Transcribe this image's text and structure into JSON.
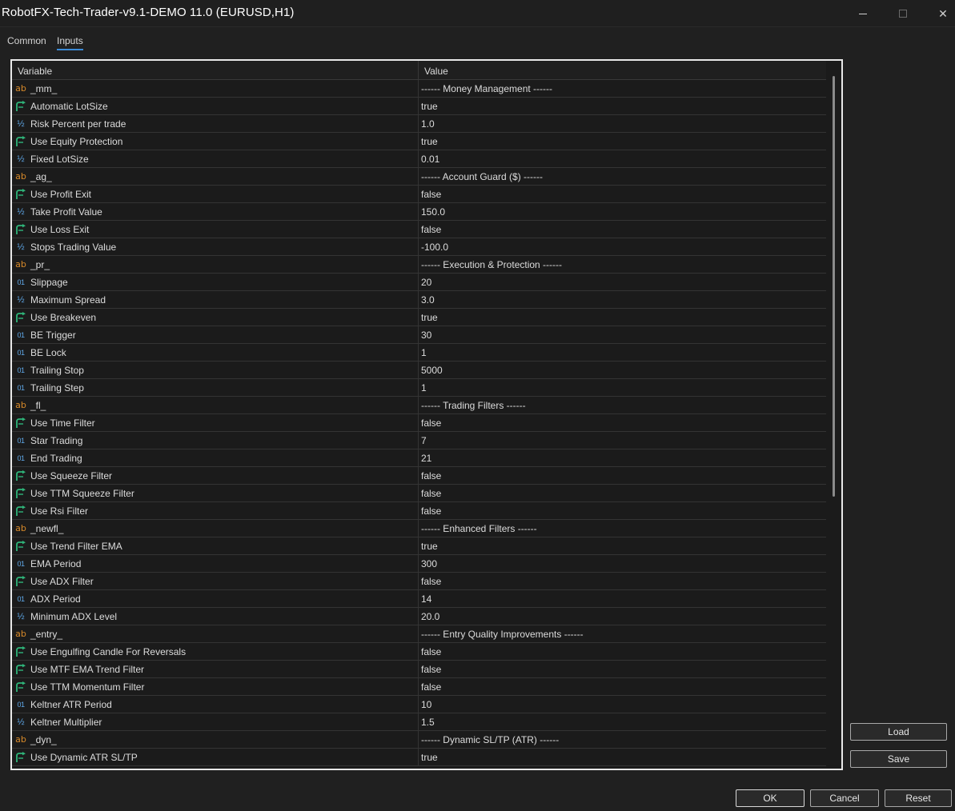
{
  "window": {
    "title": "RobotFX-Tech-Trader-v9.1-DEMO 11.0 (EURUSD,H1)",
    "close_glyph": "✕"
  },
  "tabs": [
    {
      "label": "Common",
      "active": false
    },
    {
      "label": "Inputs",
      "active": true
    }
  ],
  "table": {
    "headers": {
      "variable": "Variable",
      "value": "Value"
    },
    "rows": [
      {
        "type": "string",
        "icon": "ab",
        "name": "_mm_",
        "value": "------ Money Management ------"
      },
      {
        "type": "bool",
        "icon": "",
        "name": "Automatic LotSize",
        "value": "true"
      },
      {
        "type": "double",
        "icon": "½",
        "name": "Risk Percent per trade",
        "value": "1.0"
      },
      {
        "type": "bool",
        "icon": "",
        "name": "Use Equity Protection",
        "value": "true"
      },
      {
        "type": "double",
        "icon": "½",
        "name": "Fixed LotSize",
        "value": "0.01"
      },
      {
        "type": "string",
        "icon": "ab",
        "name": "_ag_",
        "value": "------ Account Guard ($) ------"
      },
      {
        "type": "bool",
        "icon": "",
        "name": "Use Profit Exit",
        "value": "false"
      },
      {
        "type": "double",
        "icon": "½",
        "name": "Take Profit Value",
        "value": "150.0"
      },
      {
        "type": "bool",
        "icon": "",
        "name": "Use Loss Exit",
        "value": "false"
      },
      {
        "type": "double",
        "icon": "½",
        "name": "Stops Trading Value",
        "value": "-100.0"
      },
      {
        "type": "string",
        "icon": "ab",
        "name": "_pr_",
        "value": "------ Execution & Protection ------"
      },
      {
        "type": "int",
        "icon": "01",
        "name": "Slippage",
        "value": "20"
      },
      {
        "type": "double",
        "icon": "½",
        "name": "Maximum Spread",
        "value": "3.0"
      },
      {
        "type": "bool",
        "icon": "",
        "name": "Use Breakeven",
        "value": "true"
      },
      {
        "type": "int",
        "icon": "01",
        "name": "BE Trigger",
        "value": "30"
      },
      {
        "type": "int",
        "icon": "01",
        "name": "BE Lock",
        "value": "1"
      },
      {
        "type": "int",
        "icon": "01",
        "name": "Trailing Stop",
        "value": "5000"
      },
      {
        "type": "int",
        "icon": "01",
        "name": "Trailing Step",
        "value": "1"
      },
      {
        "type": "string",
        "icon": "ab",
        "name": "_fl_",
        "value": "------ Trading Filters ------"
      },
      {
        "type": "bool",
        "icon": "",
        "name": "Use Time Filter",
        "value": "false"
      },
      {
        "type": "int",
        "icon": "01",
        "name": "Star Trading",
        "value": "7"
      },
      {
        "type": "int",
        "icon": "01",
        "name": "End Trading",
        "value": "21"
      },
      {
        "type": "bool",
        "icon": "",
        "name": "Use Squeeze Filter",
        "value": "false"
      },
      {
        "type": "bool",
        "icon": "",
        "name": "Use TTM Squeeze Filter",
        "value": "false"
      },
      {
        "type": "bool",
        "icon": "",
        "name": "Use Rsi Filter",
        "value": "false"
      },
      {
        "type": "string",
        "icon": "ab",
        "name": "_newfl_",
        "value": "------ Enhanced Filters ------"
      },
      {
        "type": "bool",
        "icon": "",
        "name": "Use Trend Filter EMA",
        "value": "true"
      },
      {
        "type": "int",
        "icon": "01",
        "name": "EMA Period",
        "value": "300"
      },
      {
        "type": "bool",
        "icon": "",
        "name": "Use ADX Filter",
        "value": "false"
      },
      {
        "type": "int",
        "icon": "01",
        "name": "ADX Period",
        "value": "14"
      },
      {
        "type": "double",
        "icon": "½",
        "name": "Minimum ADX Level",
        "value": "20.0"
      },
      {
        "type": "string",
        "icon": "ab",
        "name": "_entry_",
        "value": "------ Entry Quality Improvements ------"
      },
      {
        "type": "bool",
        "icon": "",
        "name": "Use Engulfing Candle For Reversals",
        "value": "false"
      },
      {
        "type": "bool",
        "icon": "",
        "name": "Use MTF EMA Trend Filter",
        "value": "false"
      },
      {
        "type": "bool",
        "icon": "",
        "name": "Use TTM Momentum Filter",
        "value": "false"
      },
      {
        "type": "int",
        "icon": "01",
        "name": "Keltner ATR Period",
        "value": "10"
      },
      {
        "type": "double",
        "icon": "½",
        "name": "Keltner Multiplier",
        "value": "1.5"
      },
      {
        "type": "string",
        "icon": "ab",
        "name": "_dyn_",
        "value": "------ Dynamic SL/TP (ATR) ------"
      },
      {
        "type": "bool",
        "icon": "",
        "name": "Use Dynamic ATR SL/TP",
        "value": "true"
      }
    ]
  },
  "buttons": {
    "load": "Load",
    "save": "Save",
    "ok": "OK",
    "cancel": "Cancel",
    "reset": "Reset"
  },
  "colors": {
    "string_icon": "#d88a2a",
    "number_icon": "#5fa8e8",
    "bool_icon": "#2fb57a",
    "active_tab_underline": "#3c8cd8"
  }
}
